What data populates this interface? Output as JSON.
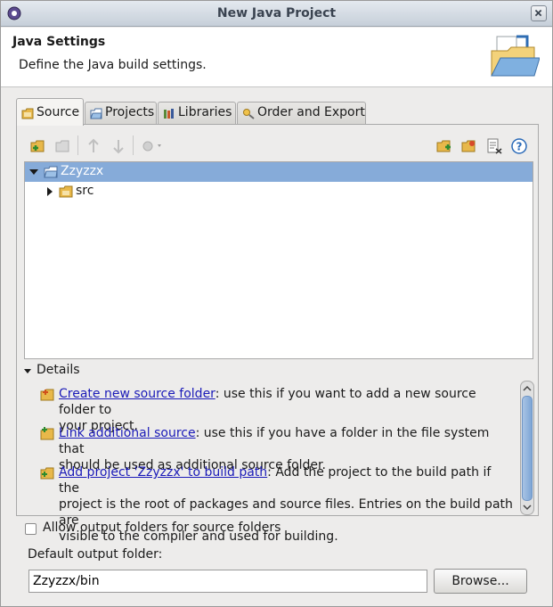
{
  "window": {
    "title": "New Java Project"
  },
  "header": {
    "title": "Java Settings",
    "description": "Define the Java build settings."
  },
  "tabs": [
    {
      "label": "Source",
      "active": true
    },
    {
      "label": "Projects"
    },
    {
      "label": "Libraries"
    },
    {
      "label": "Order and Export"
    }
  ],
  "toolbar": {
    "left_icons": [
      "create-source-folder-icon",
      "remove-icon",
      "move-up-icon",
      "move-down-icon",
      "configure-icon"
    ],
    "right_icons": [
      "link-source-icon",
      "add-folder-icon",
      "filter-icon",
      "help-icon"
    ]
  },
  "tree": {
    "items": [
      {
        "label": "Zzyzzx",
        "expanded": true,
        "selected": true
      },
      {
        "label": "src",
        "expanded": false,
        "selected": false
      }
    ]
  },
  "details": {
    "header": "Details",
    "entries": [
      {
        "link": "Create new source folder",
        "text_line1": ": use this if you want to add a new source folder to",
        "text_line2": "your project."
      },
      {
        "link": "Link additional source",
        "text_line1": ": use this if you have a folder in the file system that",
        "text_line2": "should be used as additional source folder."
      },
      {
        "link": "Add project 'Zzyzzx' to build path",
        "text_line1": ": Add the project to the build path if the",
        "text_line2": "project is the root of packages and source files. Entries on the build path are",
        "text_line3": "visible to the compiler and used for building."
      }
    ]
  },
  "options": {
    "allow_output_folders_label": "Allow output folders for source folders",
    "allow_output_folders_checked": false
  },
  "output": {
    "label": "Default output folder:",
    "value": "Zzyzzx/bin",
    "browse_label": "Browse..."
  },
  "colors": {
    "selection": "#86abd9",
    "link": "#1a1ab8",
    "folder": "#e8b84a"
  }
}
